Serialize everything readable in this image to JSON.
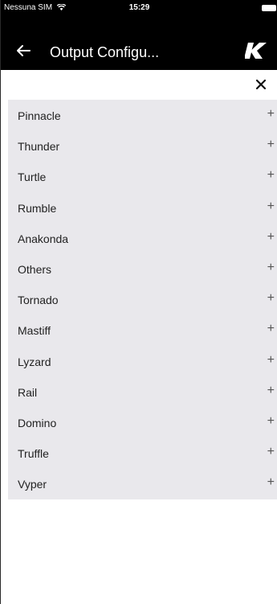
{
  "status_bar": {
    "carrier": "Nessuna SIM",
    "time": "15:29"
  },
  "header": {
    "title": "Output Configu..."
  },
  "close_button": {
    "label": "×"
  },
  "list": {
    "expand_symbol": "+",
    "items": [
      {
        "label": "Pinnacle"
      },
      {
        "label": "Thunder"
      },
      {
        "label": "Turtle"
      },
      {
        "label": "Rumble"
      },
      {
        "label": "Anakonda"
      },
      {
        "label": "Others"
      },
      {
        "label": "Tornado"
      },
      {
        "label": "Mastiff"
      },
      {
        "label": "Lyzard"
      },
      {
        "label": "Rail"
      },
      {
        "label": "Domino"
      },
      {
        "label": "Truffle"
      },
      {
        "label": "Vyper"
      }
    ]
  }
}
